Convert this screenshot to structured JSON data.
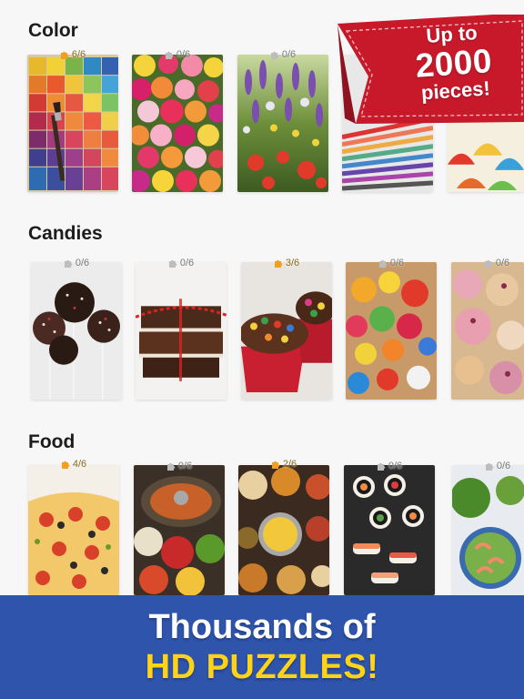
{
  "ribbon": {
    "line1": "Up to",
    "line2": "2000",
    "line3": "pieces!",
    "color": "#c7192a"
  },
  "sections": [
    {
      "title": "Color",
      "tiles": [
        {
          "progress": "6/6",
          "started": true
        },
        {
          "progress": "0/6",
          "started": false
        },
        {
          "progress": "0/6",
          "started": false
        },
        {
          "progress": "",
          "started": false
        },
        {
          "progress": "",
          "started": false
        }
      ]
    },
    {
      "title": "Candies",
      "tiles": [
        {
          "progress": "0/6",
          "started": false
        },
        {
          "progress": "0/6",
          "started": false
        },
        {
          "progress": "3/6",
          "started": true
        },
        {
          "progress": "0/6",
          "started": false
        },
        {
          "progress": "0/6",
          "started": false
        }
      ]
    },
    {
      "title": "Food",
      "tiles": [
        {
          "progress": "4/6",
          "started": true
        },
        {
          "progress": "0/6",
          "started": false
        },
        {
          "progress": "2/6",
          "started": true
        },
        {
          "progress": "0/6",
          "started": false
        },
        {
          "progress": "0/6",
          "started": false
        }
      ]
    }
  ],
  "banner": {
    "line1": "Thousands of",
    "line2": "HD PUZZLES!",
    "background": "#2e54ab",
    "highlight": "#ffd317"
  },
  "icons": {
    "badge": "puzzle-piece-icon"
  }
}
